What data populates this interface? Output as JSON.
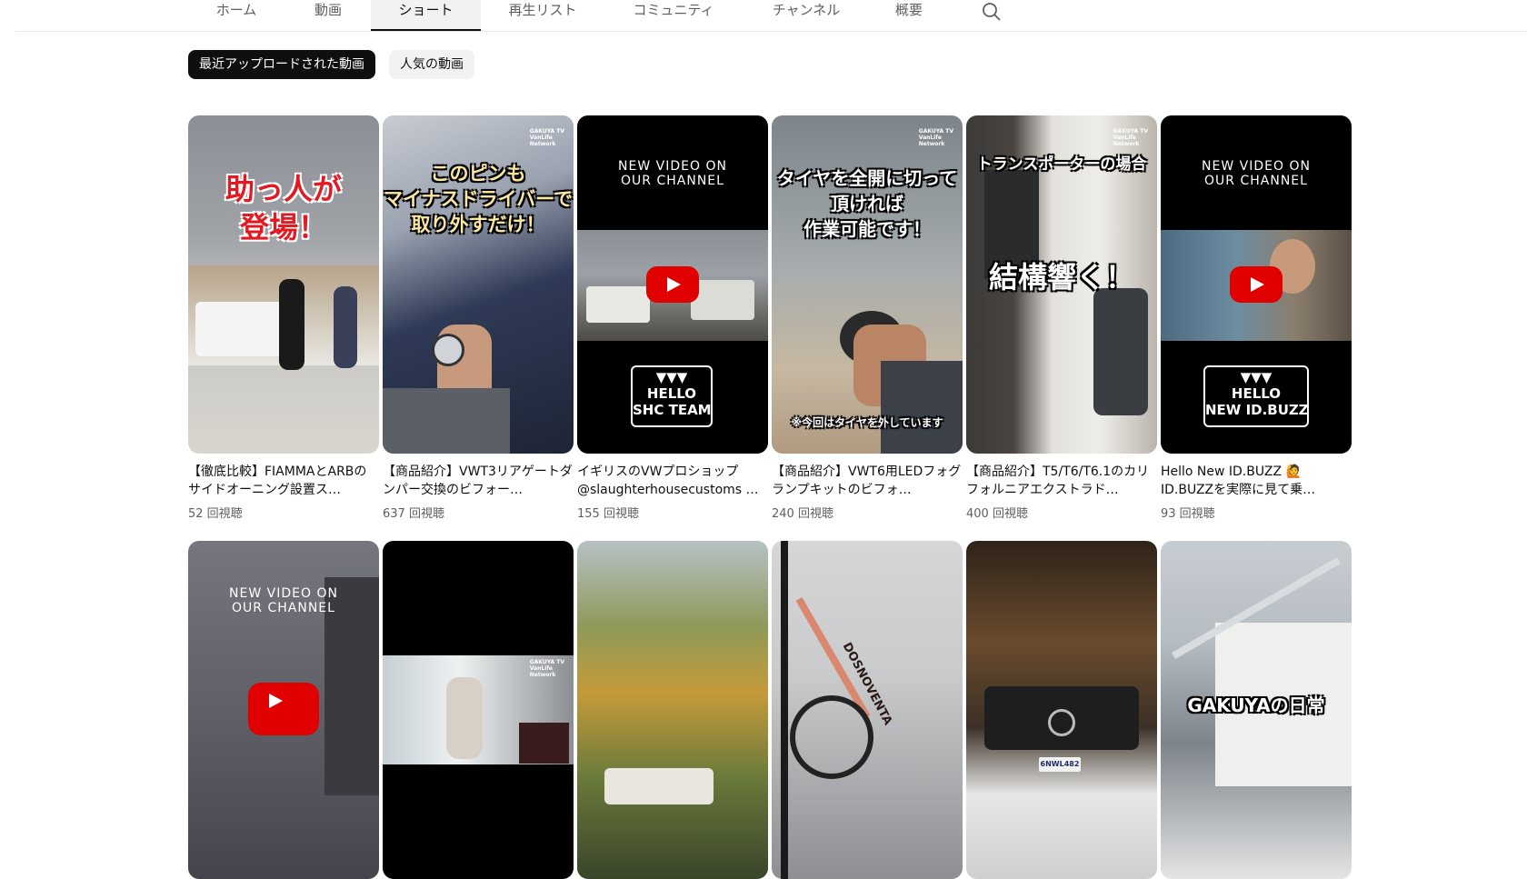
{
  "tabs": [
    {
      "label": "ホーム"
    },
    {
      "label": "動画"
    },
    {
      "label": "ショート",
      "active": true
    },
    {
      "label": "再生リスト"
    },
    {
      "label": "コミュニティ"
    },
    {
      "label": "チャンネル"
    },
    {
      "label": "概要"
    }
  ],
  "search_icon": "search-icon",
  "filters": [
    {
      "label": "最近アップロードされた動画",
      "active": true
    },
    {
      "label": "人気の動画",
      "active": false
    }
  ],
  "shorts": [
    {
      "title": "【徹底比較】FIAMMAとARBのサイドオーニング設置ス…",
      "views": "52 回視聴",
      "overlay": "助っ人が\n登場！"
    },
    {
      "title": "【商品紹介】VWT3リアゲートダンパー交換のビフォー…",
      "views": "637 回視聴",
      "overlay": "このピンも\nマイナスドライバーで\n取り外すだけ！"
    },
    {
      "title": "イギリスのVWプロショップ@slaughterhousecustoms …",
      "views": "155 回視聴",
      "overlay_top": "NEW VIDEO ON\nOUR CHANNEL",
      "overlay_box": "▼▼▼\nHELLO\nSHC TEAM"
    },
    {
      "title": "【商品紹介】VWT6用LEDフォグランプキットのビフォ…",
      "views": "240 回視聴",
      "overlay": "タイヤを全開に切って\n頂ければ\n作業可能です！",
      "note": "※今回はタイヤを外しています"
    },
    {
      "title": "【商品紹介】T5/T6/T6.1のカリフォルニアエクストラド…",
      "views": "400 回視聴",
      "overlay": "トランスポーターの場合",
      "overlay2": "結構響く！"
    },
    {
      "title": "Hello New ID.BUZZ 🙋ID.BUZZを実際に見て乗…",
      "views": "93 回視聴",
      "overlay_top": "NEW VIDEO ON\nOUR CHANNEL",
      "overlay_box": "▼▼▼\nHELLO\nNEW ID.BUZZ"
    }
  ],
  "shorts_row2": [
    {
      "overlay_top": "NEW VIDEO ON\nOUR CHANNEL"
    },
    {},
    {},
    {
      "overlay": "DOSNOVENTA"
    },
    {
      "overlay": "6NWL482"
    },
    {
      "overlay": "GAKUYAの日常"
    }
  ],
  "watermark": "GAKUYA TV\nVanLife\nNetwork",
  "colors": {
    "accent": "#0f0f0f",
    "play_red": "#e00000",
    "secondary_text": "#606060"
  }
}
